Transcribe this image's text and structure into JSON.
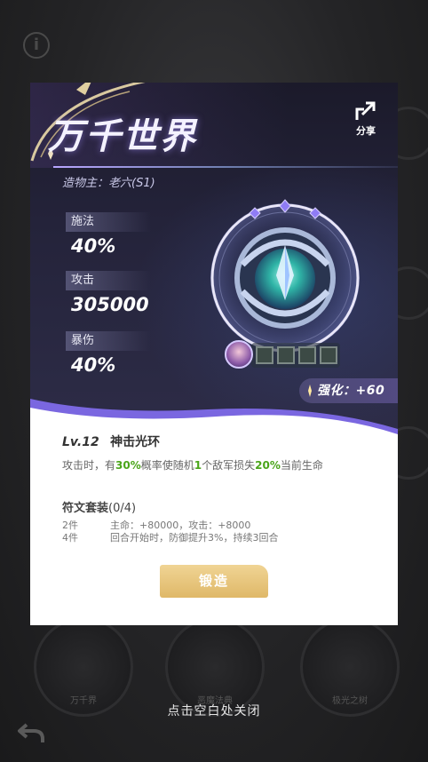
{
  "background": {
    "info_glyph": "i",
    "ring_labels": [
      "万千界",
      "恶魔法典",
      "极光之树"
    ]
  },
  "card": {
    "title": "万千世界",
    "creator": "造物主：老六(S1)",
    "share_label": "分享",
    "stats": [
      {
        "label": "施法",
        "value": "40%"
      },
      {
        "label": "攻击",
        "value": "305000"
      },
      {
        "label": "暴伤",
        "value": "40%"
      }
    ],
    "enhance": "强化：+60",
    "rune_slots": 4,
    "skill": {
      "level": "Lv.12",
      "name": "神击光环",
      "desc_parts": [
        "攻击时，有",
        "30%",
        "概率使随机",
        "1",
        "个敌军损失",
        "20%",
        "当前生命"
      ]
    },
    "rune_set": {
      "title": "符文套装",
      "count": "(0/4)",
      "rows": [
        {
          "pieces": "2件",
          "effect": "主命：+80000，攻击：+8000"
        },
        {
          "pieces": "4件",
          "effect": "回合开始时，防御提升3%，持续3回合"
        }
      ]
    },
    "forge_button": "锻造"
  },
  "close_hint": "点击空白处关闭",
  "colors": {
    "card_top": "#24233a",
    "accent_purple": "#8a7cf0",
    "highlight_green": "#4aa51a",
    "forge_gold": "#e6c077"
  },
  "icons": {
    "share": "share-icon",
    "back": "back-arrow-icon",
    "info": "info-icon"
  }
}
